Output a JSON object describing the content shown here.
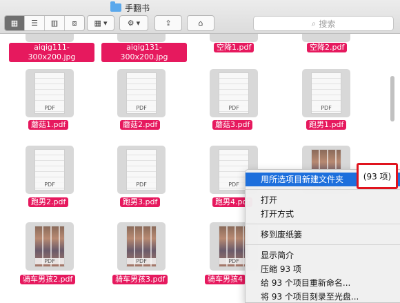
{
  "window": {
    "title": "手翻书"
  },
  "toolbar": {
    "view_buttons": [
      "icon-view",
      "list-view",
      "column-view",
      "coverflow-view"
    ],
    "search_placeholder": "搜索"
  },
  "files": {
    "row0": [
      "aiqig111-300x200.jpg",
      "aiqig131-300x200.jpg",
      "空降1.pdf",
      "空降2.pdf"
    ],
    "row1": [
      "蘑菇1.pdf",
      "蘑菇2.pdf",
      "蘑菇3.pdf",
      "跑男1.pdf"
    ],
    "row2": [
      "跑男2.pdf",
      "跑男3.pdf",
      "跑男4.pdf"
    ],
    "row3": [
      "骑车男孩2.pdf",
      "骑车男孩3.pdf",
      "骑车男孩4"
    ],
    "doc_ext": "PDF"
  },
  "context_menu": {
    "items": [
      {
        "label": "用所选项目新建文件夹",
        "highlighted": true
      },
      {
        "label": "打开"
      },
      {
        "label": "打开方式"
      },
      {
        "label": "移到废纸篓"
      },
      {
        "label": "显示简介"
      },
      {
        "label": "压缩 93 项"
      },
      {
        "label": "给 93 个项目重新命名..."
      },
      {
        "label": "将 93 个项目刻录至光盘..."
      }
    ],
    "count_callout": "(93 项)"
  },
  "colors": {
    "label_bg": "#e6195e",
    "menu_highlight": "#1d6fdc",
    "callout_border": "#e0141e"
  }
}
